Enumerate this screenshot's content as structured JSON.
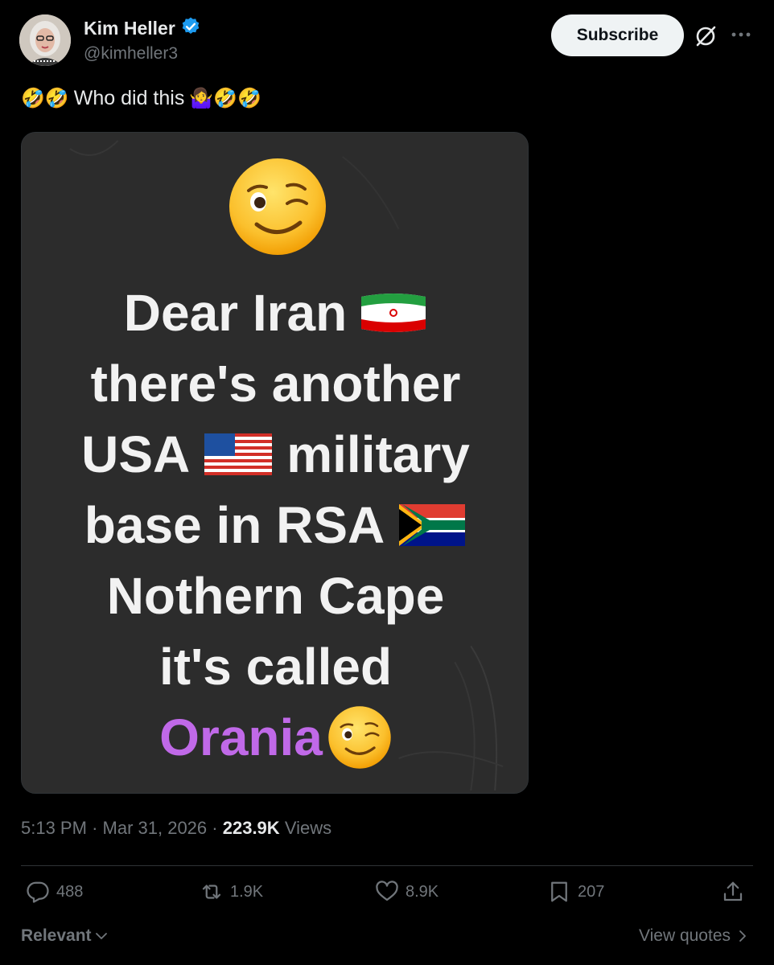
{
  "author": {
    "display_name": "Kim Heller",
    "handle": "@kimheller3",
    "verified_badge_color": "#1d9bf0"
  },
  "header": {
    "subscribe_label": "Subscribe",
    "grok_icon": "grok-icon",
    "more_icon": "more-icon"
  },
  "tweet": {
    "text": "Who did this",
    "leading_emoji": "🤣🤣",
    "trailing_emoji": "🤷‍♀️🤣🤣"
  },
  "media": {
    "background_color": "#2c2c2c",
    "lines": [
      "Dear Iran",
      "there's another",
      "USA",
      "military",
      "base in RSA",
      "Nothern Cape",
      "it's called",
      "Orania"
    ],
    "highlight_color": "#c069e8"
  },
  "meta": {
    "time": "5:13 PM",
    "separator": "·",
    "date": "Mar 31, 2026",
    "views_count": "223.9K",
    "views_label": "Views"
  },
  "actions": {
    "replies": "488",
    "reposts": "1.9K",
    "likes": "8.9K",
    "bookmarks": "207"
  },
  "footer": {
    "sort_label": "Relevant",
    "view_quotes_label": "View quotes"
  }
}
